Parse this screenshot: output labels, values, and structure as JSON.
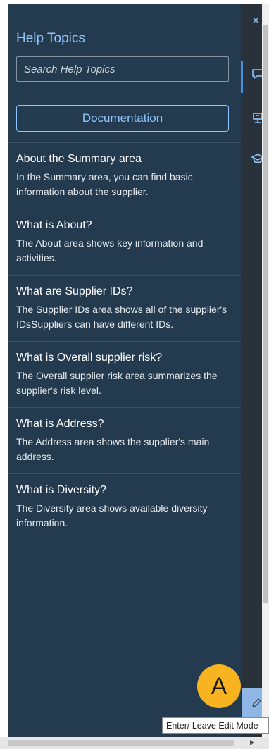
{
  "help_panel": {
    "title": "Help Topics",
    "search_placeholder": "Search Help Topics",
    "documentation_label": "Documentation",
    "topics": [
      {
        "title": "About the Summary area",
        "description": "In the Summary area, you can find basic information about the supplier."
      },
      {
        "title": "What is About?",
        "description": "The About area shows key information and activities."
      },
      {
        "title": "What are Supplier IDs?",
        "description": "The Supplier IDs area shows all of the supplier's IDsSuppliers can have different IDs."
      },
      {
        "title": "What is Overall supplier risk?",
        "description": "The Overall supplier risk area summarizes the supplier's risk level."
      },
      {
        "title": "What is Address?",
        "description": "The Address area shows the supplier's main address."
      },
      {
        "title": "What is Diversity?",
        "description": "The Diversity area shows available diversity information."
      }
    ]
  },
  "toolbar": {
    "close_glyph": "×",
    "icons": [
      "chat-icon",
      "tour-icon",
      "learning-icon",
      "pencil-icon"
    ]
  },
  "annotation": {
    "marker_label": "A"
  },
  "tooltip": {
    "text": "Enter/ Leave Edit Mode"
  },
  "colors": {
    "panel_bg": "#243a4e",
    "accent": "#8fc6ff",
    "marker": "#f7b320"
  }
}
